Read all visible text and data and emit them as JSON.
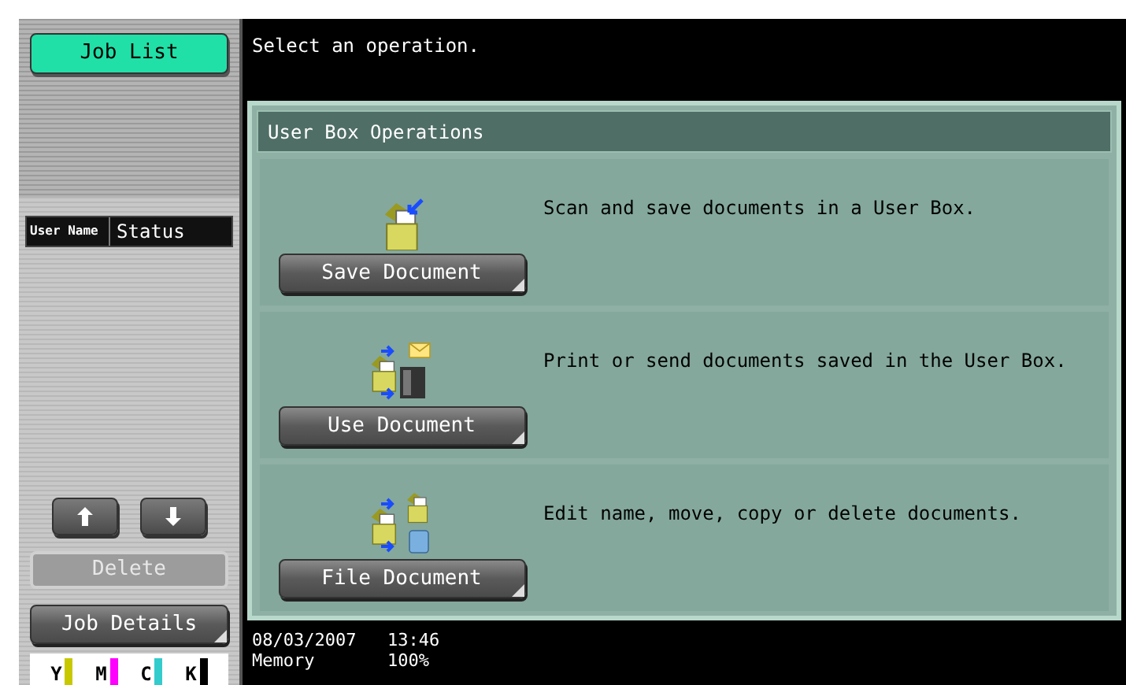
{
  "sidebar": {
    "job_list_button": "Job List",
    "table_columns": [
      "User Name",
      "Status"
    ],
    "scroll_buttons": [
      {
        "kind": "up"
      },
      {
        "kind": "down"
      }
    ],
    "delete_button": {
      "label": "Delete",
      "disabled": true
    },
    "job_details_button": "Job Details",
    "toners": [
      {
        "letter": "Y",
        "color": "#c8c800"
      },
      {
        "letter": "M",
        "color": "#ff00ff"
      },
      {
        "letter": "C",
        "color": "#33cccc"
      },
      {
        "letter": "K",
        "color": "#000000"
      }
    ]
  },
  "message": "Select an operation.",
  "panel": {
    "title": "User Box Operations",
    "operations": [
      {
        "kind": "save",
        "button": "Save Document",
        "description": "Scan and save documents in a User Box."
      },
      {
        "kind": "use",
        "button": "Use Document",
        "description": "Print or send documents saved in the User Box."
      },
      {
        "kind": "file",
        "button": "File Document",
        "description": "Edit name, move, copy or delete documents."
      }
    ]
  },
  "status_bar": {
    "date": "08/03/2007",
    "time": "13:46",
    "memory_label": "Memory",
    "memory_value": "100%"
  }
}
